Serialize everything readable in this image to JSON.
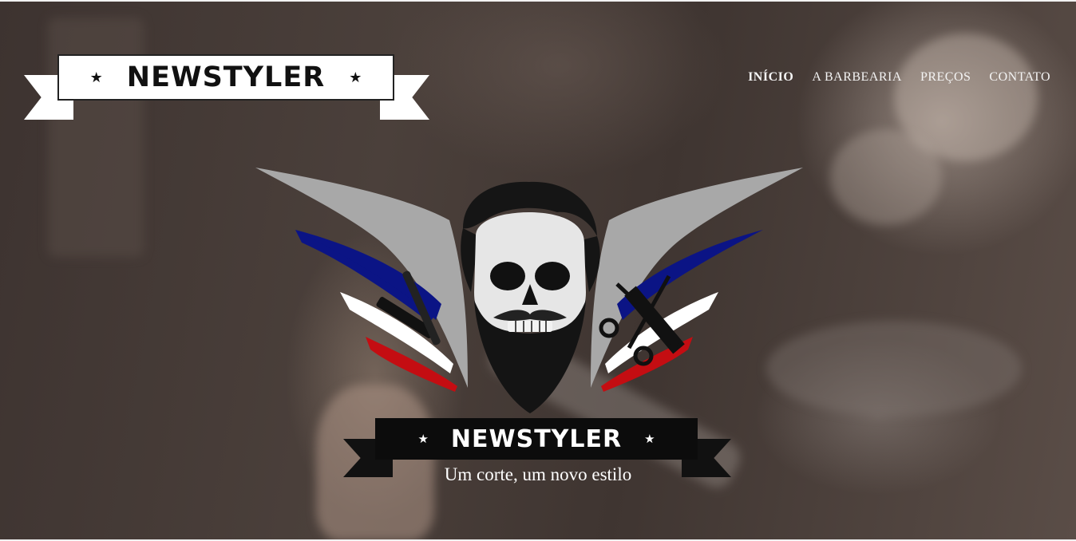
{
  "brand": {
    "name": "NEWSTYLER",
    "star": "★"
  },
  "nav": {
    "items": [
      {
        "label": "INÍCIO",
        "active": true
      },
      {
        "label": "A BARBEARIA",
        "active": false
      },
      {
        "label": "PREÇOS",
        "active": false
      },
      {
        "label": "CONTATO",
        "active": false
      }
    ]
  },
  "hero": {
    "emblem_name": "NEWSTYLER",
    "tagline": "Um corte, um novo estilo"
  },
  "colors": {
    "wing_gray": "#a8a8a8",
    "stripe_blue": "#0b1485",
    "stripe_red": "#c40d12",
    "stripe_white": "#ffffff",
    "overlay": "#3d3330"
  }
}
